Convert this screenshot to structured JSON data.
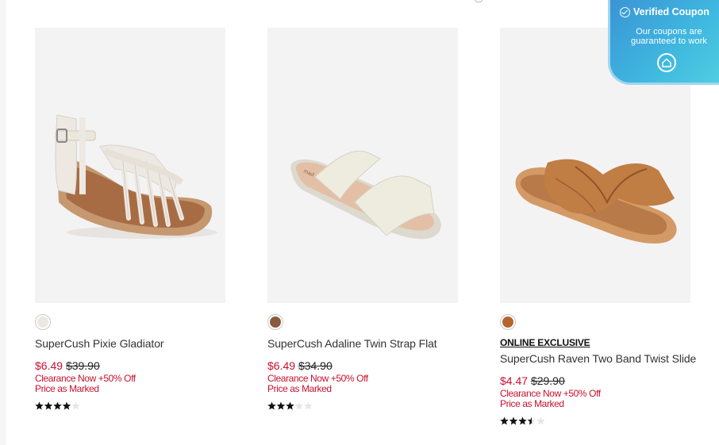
{
  "products": [
    {
      "name": "SuperCush Pixie Gladiator",
      "sale_price": "$6.49",
      "original_price": "$39.90",
      "promo_line1": "Clearance Now +50% Off",
      "promo_line2": "Price as Marked",
      "exclusive_label": "",
      "rating_out_of_5": 4,
      "swatch_color": "#ece8df",
      "image_icon": "gladiator-sandal-image"
    },
    {
      "name": "SuperCush Adaline Twin Strap Flat",
      "sale_price": "$6.49",
      "original_price": "$34.90",
      "promo_line1": "Clearance Now +50% Off",
      "promo_line2": "Price as Marked",
      "exclusive_label": "",
      "rating_out_of_5": 3,
      "swatch_color": "#8a5a3f",
      "image_icon": "twin-strap-slide-image"
    },
    {
      "name": "SuperCush Raven Two Band Twist Slide",
      "sale_price": "$4.47",
      "original_price": "$29.90",
      "promo_line1": "Clearance Now +50% Off",
      "promo_line2": "Price as Marked",
      "exclusive_label": "ONLINE EXCLUSIVE",
      "rating_out_of_5": 3.5,
      "swatch_color": "#b5652c",
      "image_icon": "twist-slide-image"
    }
  ],
  "coupon_banner": {
    "title": "Verified Coupon",
    "subtitle": "Our coupons are guaranteed to work",
    "icon": "house-logo-icon"
  },
  "colors": {
    "sale_red": "#c8102e",
    "coupon_gradient_start": "#3a93d4",
    "coupon_gradient_end": "#53d2df"
  }
}
